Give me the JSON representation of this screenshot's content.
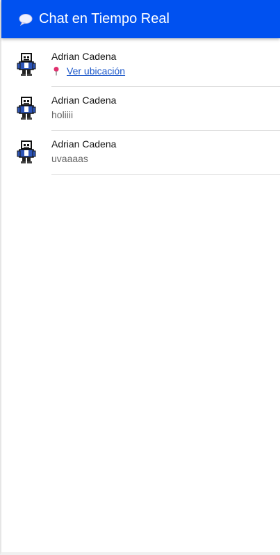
{
  "header": {
    "title": "Chat en Tiempo Real",
    "icon": "speech-bubble-icon",
    "background": "#0051f0"
  },
  "messages": [
    {
      "author": "Adrian Cadena",
      "type": "location",
      "text": "Ver ubicación",
      "icon": "pin-icon"
    },
    {
      "author": "Adrian Cadena",
      "type": "text",
      "text": "holiiii"
    },
    {
      "author": "Adrian Cadena",
      "type": "text",
      "text": "uvaaaas"
    }
  ]
}
